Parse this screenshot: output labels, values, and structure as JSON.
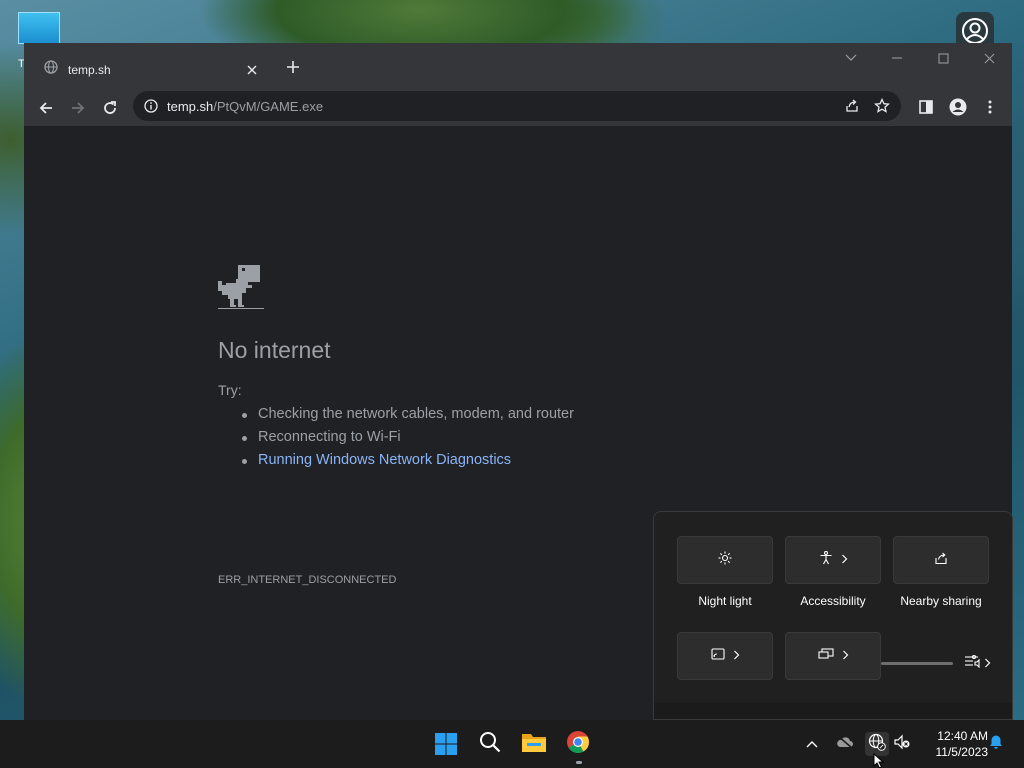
{
  "desktop": {
    "icon_label": "T"
  },
  "browser": {
    "tab_title": "temp.sh",
    "url_host": "temp.sh",
    "url_path": "/PtQvM/GAME.exe"
  },
  "error_page": {
    "title": "No internet",
    "try_label": "Try:",
    "tips": [
      "Checking the network cables, modem, and router",
      "Reconnecting to Wi-Fi"
    ],
    "diagnostics_link": "Running Windows Network Diagnostics",
    "error_code": "ERR_INTERNET_DISCONNECTED"
  },
  "quick_settings": {
    "tiles": [
      {
        "label": "Night light",
        "icon": "night-light-icon"
      },
      {
        "label": "Accessibility",
        "icon": "accessibility-icon"
      },
      {
        "label": "Nearby sharing",
        "icon": "nearby-sharing-icon"
      },
      {
        "label": "",
        "icon": "cast-icon"
      },
      {
        "label": "",
        "icon": "project-icon"
      }
    ]
  },
  "taskbar": {
    "time": "12:40 AM",
    "date": "11/5/2023"
  },
  "colors": {
    "link": "#8ab4f8",
    "page_bg": "#202124",
    "chrome_bar": "#35363a"
  }
}
